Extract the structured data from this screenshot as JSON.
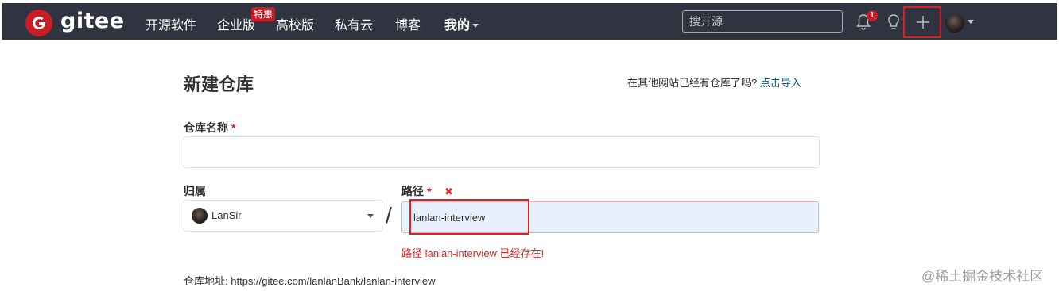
{
  "header": {
    "logo_text": "gitee",
    "nav": [
      {
        "label": "开源软件"
      },
      {
        "label": "企业版",
        "badge": "特惠"
      },
      {
        "label": "高校版"
      },
      {
        "label": "私有云"
      },
      {
        "label": "博客"
      },
      {
        "label": "我的"
      }
    ],
    "search_placeholder": "搜开源",
    "notification_count": "1"
  },
  "form": {
    "title": "新建仓库",
    "import_hint": "在其他网站已经有仓库了吗?",
    "import_link": "点击导入",
    "repo_name_label": "仓库名称",
    "required_mark": "*",
    "owner_label": "归属",
    "owner_value": "LanSir",
    "path_label": "路径",
    "path_separator": "/",
    "path_value": "lanlan-interview",
    "path_error_icon": "✖",
    "path_error": "路径 lanlan-interview 已经存在!",
    "repo_url_label": "仓库地址:",
    "repo_url": "https://gitee.com/lanlanBank/lanlan-interview"
  },
  "watermark": "@稀土掘金技术社区",
  "colors": {
    "header_bg": "#2f3440",
    "brand_red": "#c71d23",
    "link": "#005980",
    "error": "#db2828",
    "highlight_box": "#e02020"
  }
}
